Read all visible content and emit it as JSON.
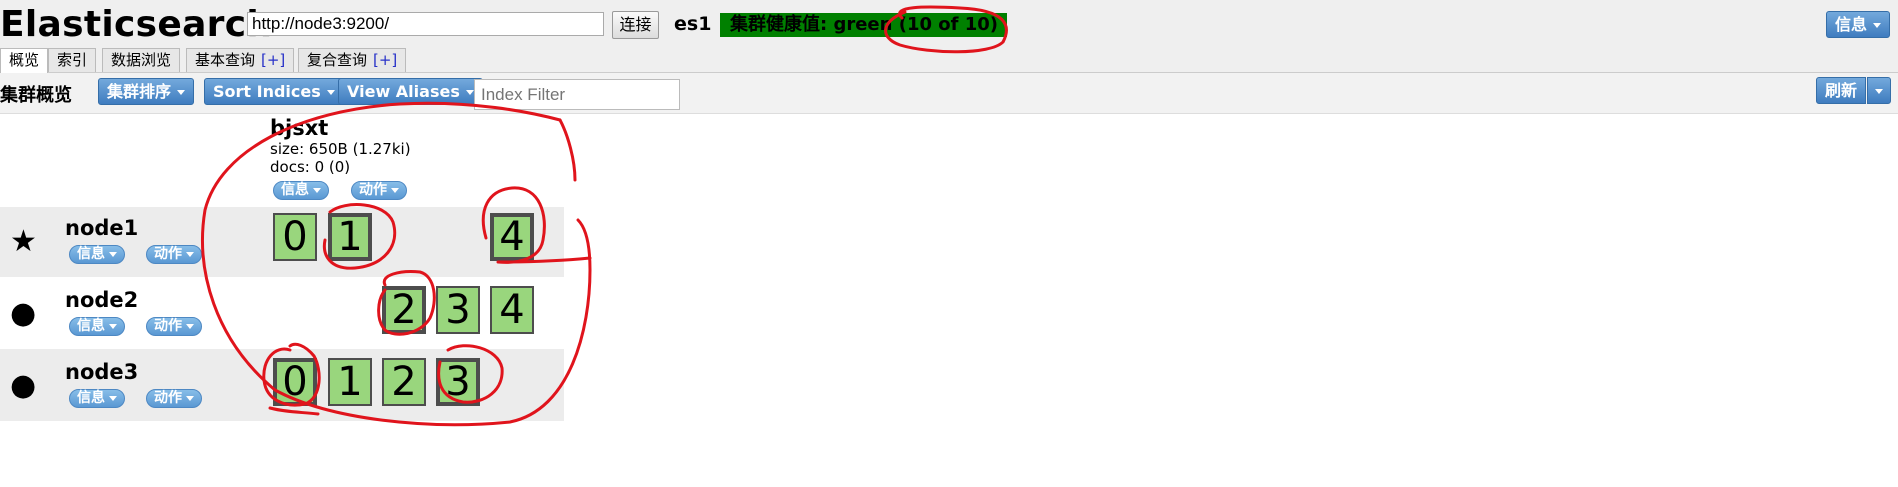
{
  "header": {
    "title": "Elasticsearch",
    "url_value": "http://node3:9200/",
    "connect_label": "连接",
    "cluster_name": "es1",
    "health_text": "集群健康值: green (10 of 10)",
    "info_label": "信息"
  },
  "tabs": [
    {
      "label": "概览",
      "plus": ""
    },
    {
      "label": "索引",
      "plus": ""
    },
    {
      "label": "数据浏览",
      "plus": ""
    },
    {
      "label": "基本查询",
      "plus": "[+]"
    },
    {
      "label": "复合查询",
      "plus": "[+]"
    }
  ],
  "toolbar": {
    "title": "集群概览",
    "cluster_sort": "集群排序",
    "sort_indices": "Sort Indices",
    "view_aliases": "View Aliases",
    "index_filter_placeholder": "Index Filter",
    "refresh_label": "刷新"
  },
  "index": {
    "name": "bjsxt",
    "size": "size: 650B (1.27ki)",
    "docs": "docs: 0 (0)",
    "info_label": "信息",
    "action_label": "动作"
  },
  "nodes": [
    {
      "name": "node1",
      "icon": "star-icon",
      "symbol": "★",
      "info_label": "信息",
      "action_label": "动作",
      "shards": [
        "0",
        "1",
        "4"
      ]
    },
    {
      "name": "node2",
      "icon": "circle-icon",
      "symbol": "●",
      "info_label": "信息",
      "action_label": "动作",
      "shards": [
        "2",
        "3",
        "4"
      ]
    },
    {
      "name": "node3",
      "icon": "circle-icon",
      "symbol": "●",
      "info_label": "信息",
      "action_label": "动作",
      "shards": [
        "0",
        "1",
        "2",
        "3"
      ]
    }
  ],
  "colors": {
    "health_green": "#008000",
    "shard_fill": "#99d67d",
    "button_blue": "#3f7cbf",
    "annotation_red": "#e0141c"
  }
}
